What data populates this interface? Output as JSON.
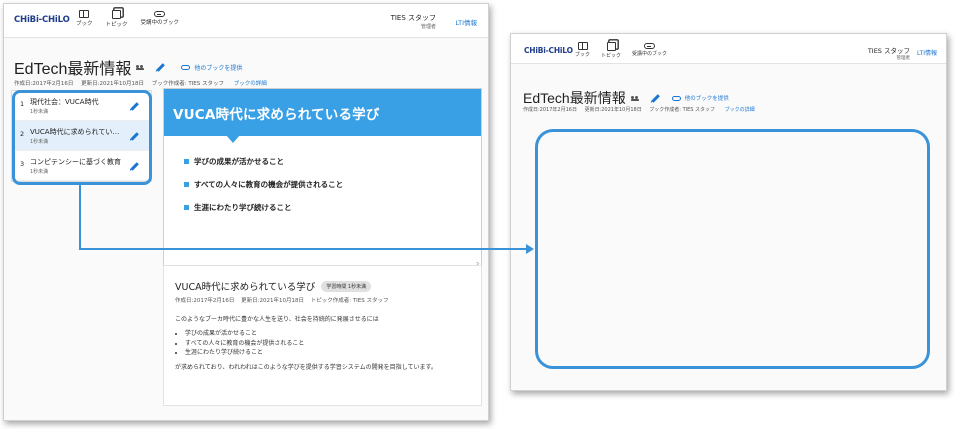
{
  "left_window": {
    "header": {
      "logo": "CHiBi-CHiLO",
      "nav": [
        "ブック",
        "トピック",
        "受講中のブック"
      ],
      "user_name": "TIES スタッフ",
      "user_role": "管理者",
      "lti": "LTI情報"
    },
    "book": {
      "title": "EdTech最新情報",
      "suggest": "他のブックを提供",
      "created": "作成日:2017年2月16日",
      "updated": "更新日:2021年10月18日",
      "author": "ブック作成者: TIES スタッフ",
      "details_link": "ブックの詳細"
    },
    "sidebar": [
      {
        "num": "1",
        "title": "現代社会：VUCA時代",
        "time": "1秒未満"
      },
      {
        "num": "2",
        "title": "VUCA時代に求められてい…",
        "time": "1秒未満"
      },
      {
        "num": "3",
        "title": "コンピテンシーに基づく教育",
        "time": "1秒未満"
      }
    ],
    "slide": {
      "title": "VUCA時代に求められている学び",
      "bullets": [
        "学びの成果が活かせること",
        "すべての人々に教育の機会が提供されること",
        "生涯にわたり学び続けること"
      ],
      "page": "2"
    },
    "topic": {
      "title": "VUCA時代に求められている学び",
      "chip": "学習時間 1秒未満",
      "created": "作成日:2017年2月16日",
      "updated": "更新日:2021年10月18日",
      "author": "トピック作成者: TIES スタッフ",
      "intro": "このようなブーカ時代に豊かな人生を送り、社会を持続的に発展させるには",
      "items": [
        "学びの成果が活かせること",
        "すべての人々に教育の機会が提供されること",
        "生涯にわたり学び続けること"
      ],
      "outro": "が求められており、われわれはこのような学びを提供する学習システムの開発を目指しています。"
    }
  },
  "right_window": {
    "header": {
      "logo": "CHiBi-CHiLO",
      "nav": [
        "ブック",
        "トピック",
        "受講中のブック"
      ],
      "user_name": "TIES スタッフ",
      "user_role": "管理者",
      "lti": "LTI情報"
    },
    "book": {
      "title": "EdTech最新情報",
      "suggest": "他のブックを提供",
      "created": "作成日:2017年2月16日",
      "updated": "更新日:2021年10月18日",
      "author": "ブック作成者: TIES スタッフ",
      "details_link": "ブックの詳細"
    }
  },
  "colors": {
    "accent": "#1976d2",
    "highlight": "#3a92d8",
    "slide_banner": "#3aa0e6",
    "logo": "#1f3d8a"
  }
}
